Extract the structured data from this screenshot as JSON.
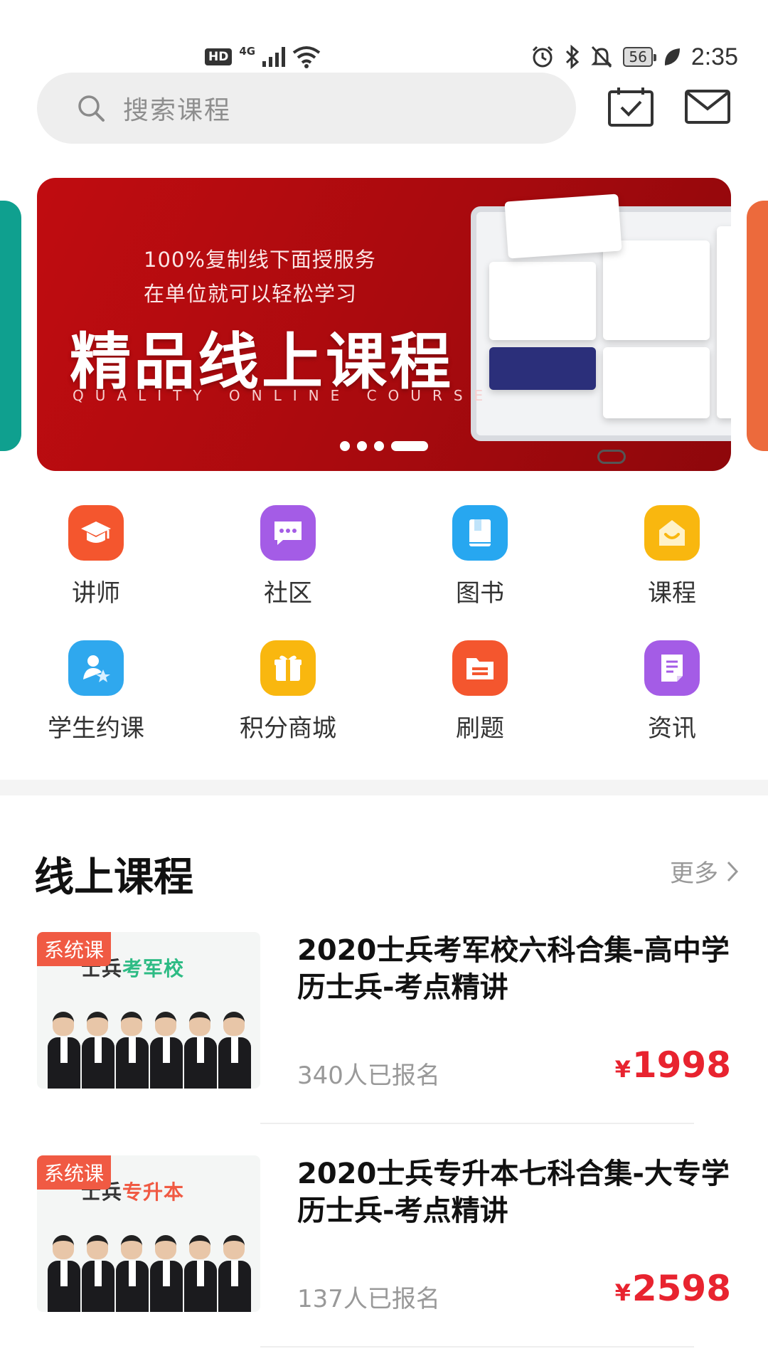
{
  "status_bar": {
    "hd": "HD",
    "network": "4G",
    "battery": "56",
    "time": "2:35"
  },
  "search": {
    "placeholder": "搜索课程"
  },
  "banner": {
    "line1": "100%复制线下面授服务",
    "line2": "在单位就可以轻松学习",
    "title": "精品线上课程",
    "subtitle": "QUALITY ONLINE COURSE",
    "active_index": 3,
    "count": 4
  },
  "grid": [
    {
      "label": "讲师",
      "icon": "graduation-cap-icon",
      "color": "#f4562e"
    },
    {
      "label": "社区",
      "icon": "chat-bubble-icon",
      "color": "#a45ce6"
    },
    {
      "label": "图书",
      "icon": "book-icon",
      "color": "#27a7f0"
    },
    {
      "label": "课程",
      "icon": "smile-house-icon",
      "color": "#f9b70f"
    },
    {
      "label": "学生约课",
      "icon": "student-star-icon",
      "color": "#2fa8ee"
    },
    {
      "label": "积分商城",
      "icon": "gift-icon",
      "color": "#f9b70f"
    },
    {
      "label": "刷题",
      "icon": "folder-icon",
      "color": "#f4562e"
    },
    {
      "label": "资讯",
      "icon": "document-icon",
      "color": "#a45ce6"
    }
  ],
  "section": {
    "title": "线上课程",
    "more": "更多"
  },
  "courses": [
    {
      "tag": "系统课",
      "thumb_title_a": "士兵",
      "thumb_title_b": "考军校",
      "title": "2020士兵考军校六科合集-高中学历士兵-考点精讲",
      "enrolled": "340人已报名",
      "currency": "¥",
      "price": "1998"
    },
    {
      "tag": "系统课",
      "thumb_title_a": "士兵",
      "thumb_title_b": "专升本",
      "title": "2020士兵专升本七科合集-大专学历士兵-考点精讲",
      "enrolled": "137人已报名",
      "currency": "¥",
      "price": "2598"
    }
  ],
  "colors": {
    "banner_red": "#c00c10",
    "price_red": "#e8232f",
    "tag_orange": "#f05a43"
  }
}
